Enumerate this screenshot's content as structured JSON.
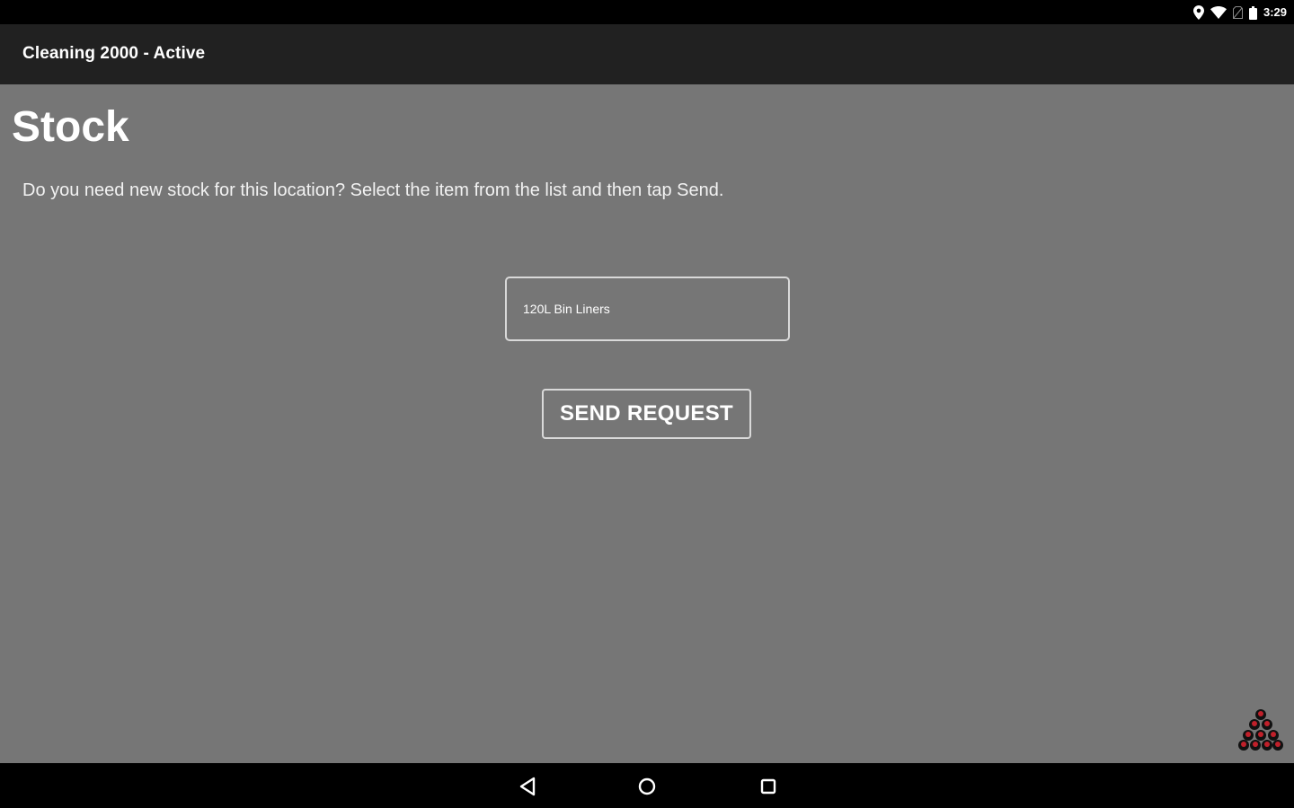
{
  "status_bar": {
    "time": "3:29",
    "icons": [
      "location-icon",
      "wifi-icon",
      "no-sim-icon",
      "battery-icon"
    ]
  },
  "app_bar": {
    "title": "Cleaning 2000 - Active"
  },
  "main": {
    "title": "Stock",
    "instructions": "Do you need new stock for this location? Select the item from the list and then tap Send.",
    "stock_select": {
      "selected_value": "120L Bin Liners"
    },
    "send_button_label": "SEND REQUEST"
  },
  "nav_bar": {
    "buttons": [
      "back-icon",
      "home-icon",
      "recents-icon"
    ]
  },
  "colors": {
    "background": "#767676",
    "app_bar": "#212121",
    "system_bars": "#000000",
    "logo_accent": "#c0202a"
  }
}
